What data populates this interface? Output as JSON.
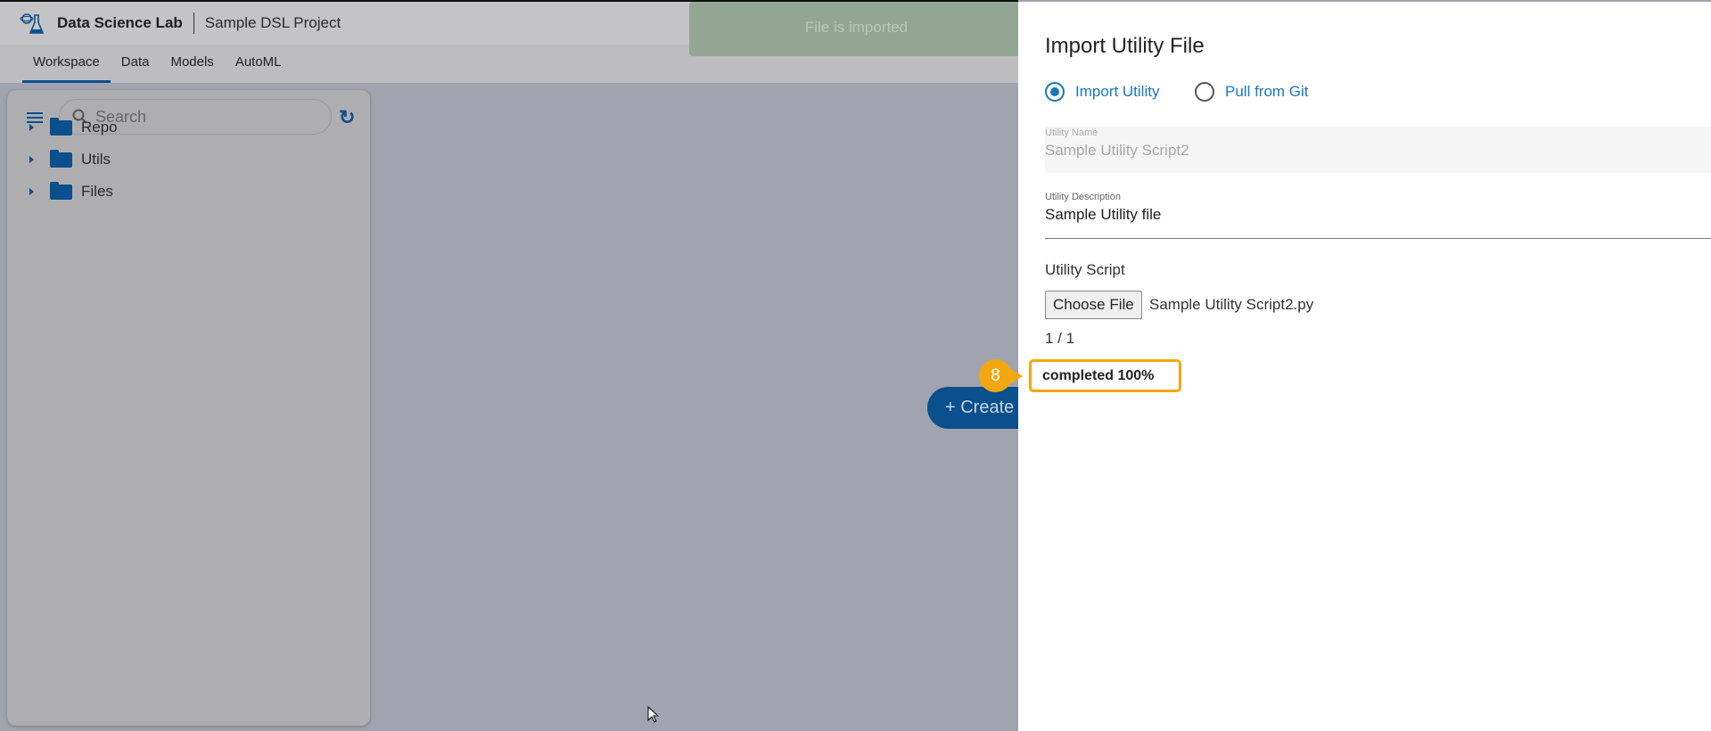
{
  "header": {
    "app_title": "Data Science Lab",
    "project": "Sample DSL Project"
  },
  "tabs": [
    {
      "label": "Workspace",
      "active": true
    },
    {
      "label": "Data"
    },
    {
      "label": "Models"
    },
    {
      "label": "AutoML"
    }
  ],
  "sidebar": {
    "search_placeholder": "Search",
    "tree": [
      {
        "label": "Repo"
      },
      {
        "label": "Utils"
      },
      {
        "label": "Files"
      }
    ]
  },
  "toast": {
    "message": "File is imported"
  },
  "create_button": {
    "label": "+ Create"
  },
  "drawer": {
    "title": "Import Utility File",
    "radios": [
      {
        "label": "Import Utility",
        "selected": true
      },
      {
        "label": "Pull from Git",
        "selected": false
      }
    ],
    "utility_name": {
      "label": "Utility Name",
      "value": "Sample Utility Script2"
    },
    "utility_description": {
      "label": "Utility Description",
      "value": "Sample Utility file"
    },
    "utility_script": {
      "label": "Utility Script",
      "button": "Choose File",
      "file_name": "Sample Utility Script2.py"
    },
    "file_count": "1 / 1",
    "status": "completed 100%",
    "progress_percent": 100
  },
  "annotation": {
    "step": "8",
    "color": "#f2a60f"
  }
}
